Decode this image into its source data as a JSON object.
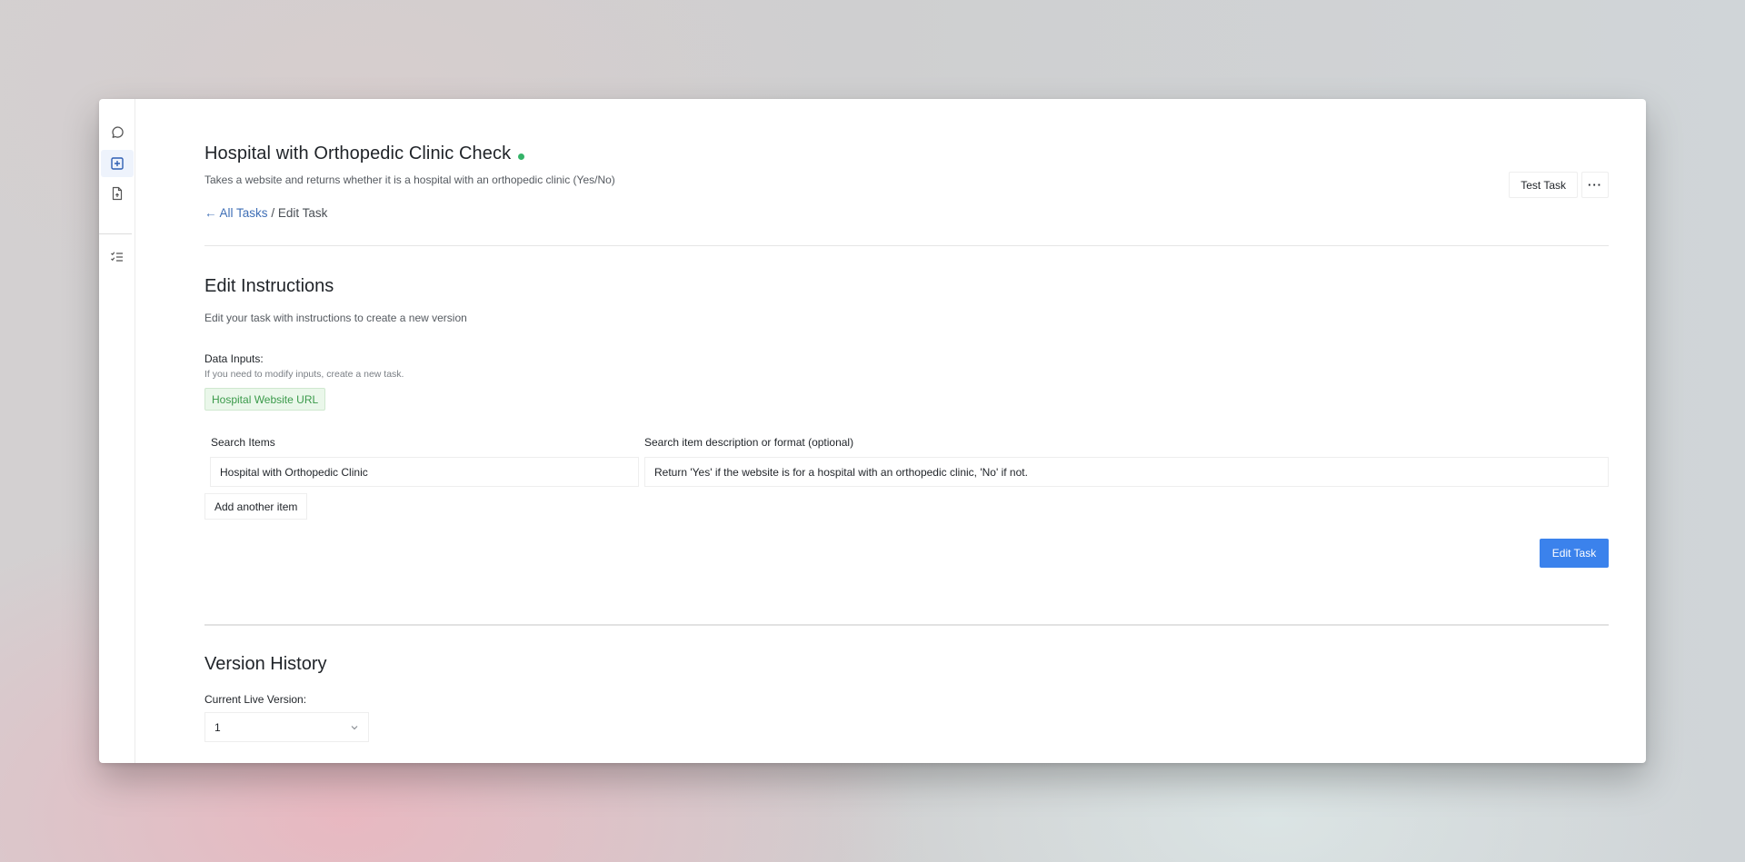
{
  "sidebar": {
    "items": [
      {
        "icon": "chat-icon",
        "active": false
      },
      {
        "icon": "add-square-icon",
        "active": true
      },
      {
        "icon": "file-upload-icon",
        "active": false
      },
      {
        "icon": "checklist-icon",
        "active": false
      }
    ]
  },
  "header": {
    "title": "Hospital with Orthopedic Clinic Check",
    "status_color": "#34b368",
    "subtitle": "Takes a website and returns whether it is a hospital with an orthopedic clinic (Yes/No)",
    "breadcrumb": {
      "back_arrow": "←",
      "back_label": "All Tasks",
      "separator": "/",
      "current": "Edit Task"
    },
    "actions": {
      "test_task_label": "Test Task",
      "more_label": "···"
    }
  },
  "edit_instructions": {
    "heading": "Edit Instructions",
    "description": "Edit your task with instructions to create a new version",
    "data_inputs_label": "Data Inputs:",
    "data_inputs_hint": "If you need to modify inputs, create a new task.",
    "inputs": [
      "Hospital Website URL"
    ],
    "columns": {
      "search_items": "Search Items",
      "description": "Search item description or format (optional)"
    },
    "items": [
      {
        "name": "Hospital with Orthopedic Clinic",
        "description": "Return 'Yes' if the website is for a hospital with an orthopedic clinic, 'No' if not."
      }
    ],
    "add_item_label": "Add another item",
    "submit_label": "Edit Task",
    "accent_color": "#3b82ec"
  },
  "version_history": {
    "heading": "Version History",
    "current_live_label": "Current Live Version:",
    "selected_version": "1"
  }
}
